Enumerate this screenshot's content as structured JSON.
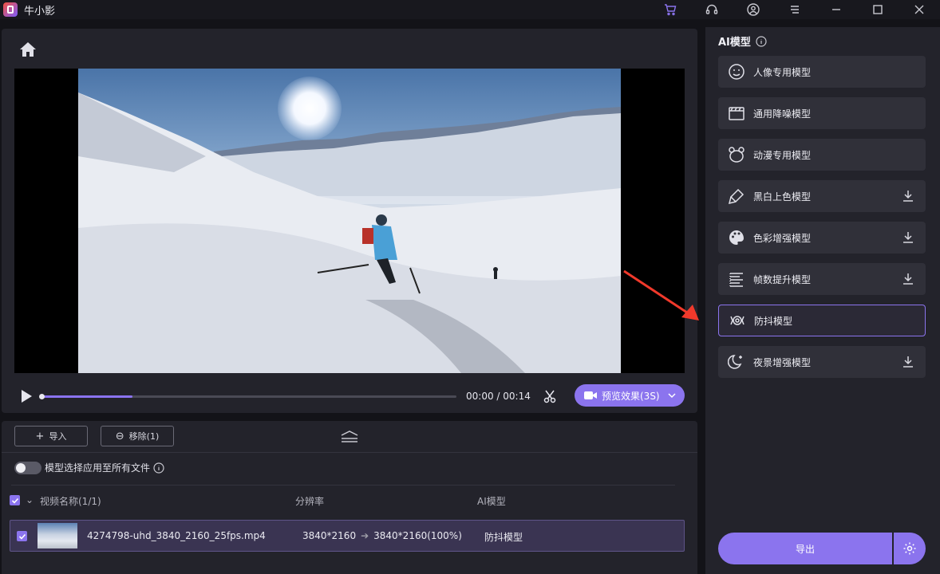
{
  "app": {
    "title": "牛小影"
  },
  "player": {
    "current_time": "00:00",
    "total_time": "00:14",
    "time_separator": " / ",
    "progress": 0.22,
    "preview_label": "预览效果(3S)"
  },
  "toolbar": {
    "import_label": "导入",
    "remove_label": "移除(1)"
  },
  "apply_all": {
    "label": "模型选择应用至所有文件",
    "enabled": false
  },
  "table": {
    "headers": {
      "name": "视频名称(1/1)",
      "resolution": "分辨率",
      "model": "AI模型"
    },
    "rows": [
      {
        "checked": true,
        "file": "4274798-uhd_3840_2160_25fps.mp4",
        "res_from": "3840*2160",
        "res_to": "3840*2160(100%)",
        "model": "防抖模型"
      }
    ]
  },
  "side": {
    "title": "AI模型",
    "models": [
      {
        "label": "人像专用模型",
        "icon": "face-icon",
        "download": false,
        "active": false
      },
      {
        "label": "通用降噪模型",
        "icon": "clapper-icon",
        "download": false,
        "active": false
      },
      {
        "label": "动漫专用模型",
        "icon": "bear-icon",
        "download": false,
        "active": false
      },
      {
        "label": "黑白上色模型",
        "icon": "brush-icon",
        "download": true,
        "active": false
      },
      {
        "label": "色彩增强模型",
        "icon": "palette-icon",
        "download": true,
        "active": false
      },
      {
        "label": "帧数提升模型",
        "icon": "frames-icon",
        "download": true,
        "active": false
      },
      {
        "label": "防抖模型",
        "icon": "stabilize-icon",
        "download": false,
        "active": true
      },
      {
        "label": "夜景增强模型",
        "icon": "moon-icon",
        "download": true,
        "active": false
      }
    ],
    "export_label": "导出"
  },
  "colors": {
    "accent": "#8b74ee",
    "panel": "#23232b",
    "arrow": "#f0392b"
  }
}
